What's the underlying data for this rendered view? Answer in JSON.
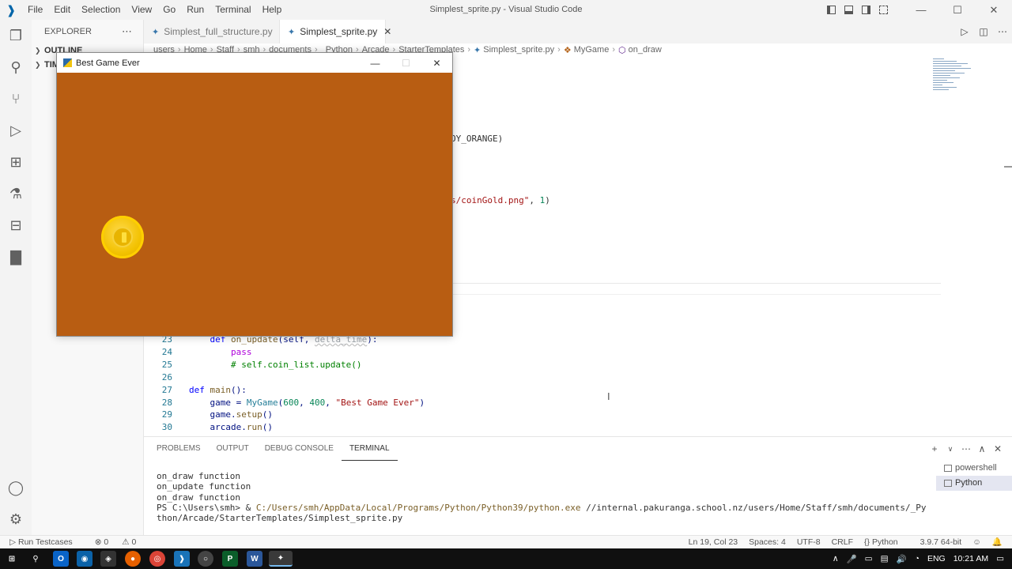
{
  "window": {
    "title": "Simplest_sprite.py - Visual Studio Code"
  },
  "menu": [
    "File",
    "Edit",
    "Selection",
    "View",
    "Go",
    "Run",
    "Terminal",
    "Help"
  ],
  "sidebar": {
    "header": "EXPLORER",
    "more": "⋯",
    "sections": [
      {
        "label": "OUTLINE"
      },
      {
        "label": "TIM"
      }
    ]
  },
  "tabs": [
    {
      "label": "Simplest_full_structure.py",
      "active": false
    },
    {
      "label": "Simplest_sprite.py",
      "active": true
    }
  ],
  "breadcrumb": [
    "users",
    "Home",
    "Staff",
    "smh",
    "documents",
    "_Python",
    "Arcade",
    "StarterTemplates",
    "Simplest_sprite.py",
    "MyGame",
    "on_draw"
  ],
  "editor": {
    "fragments": {
      "orange_tail": "OY_ORANGE)",
      "coin_path": "s/coinGold.png\"",
      "coin_scale": "1"
    },
    "lines": [
      {
        "num": "23",
        "parts": [
          {
            "t": "    "
          },
          {
            "t": "def",
            "c": "kw"
          },
          {
            "t": " "
          },
          {
            "t": "on_update",
            "c": "fn"
          },
          {
            "t": "(self, "
          },
          {
            "t": "delta_time",
            "c": "param"
          },
          {
            "t": "):"
          }
        ]
      },
      {
        "num": "24",
        "parts": [
          {
            "t": "        "
          },
          {
            "t": "pass",
            "c": "kw2"
          }
        ]
      },
      {
        "num": "25",
        "parts": [
          {
            "t": "        "
          },
          {
            "t": "# self.coin_list.update()",
            "c": "cmt"
          }
        ]
      },
      {
        "num": "26",
        "parts": []
      },
      {
        "num": "27",
        "parts": [
          {
            "t": "def",
            "c": "kw"
          },
          {
            "t": " "
          },
          {
            "t": "main",
            "c": "fn"
          },
          {
            "t": "():"
          }
        ]
      },
      {
        "num": "28",
        "parts": [
          {
            "t": "    game = "
          },
          {
            "t": "MyGame",
            "c": "cls"
          },
          {
            "t": "("
          },
          {
            "t": "600",
            "c": "num"
          },
          {
            "t": ", "
          },
          {
            "t": "400",
            "c": "num"
          },
          {
            "t": ", "
          },
          {
            "t": "\"Best Game Ever\"",
            "c": "str"
          },
          {
            "t": ")"
          }
        ]
      },
      {
        "num": "29",
        "parts": [
          {
            "t": "    game."
          },
          {
            "t": "setup",
            "c": "fn"
          },
          {
            "t": "()"
          }
        ]
      },
      {
        "num": "30",
        "parts": [
          {
            "t": "    arcade."
          },
          {
            "t": "run",
            "c": "fn"
          },
          {
            "t": "()"
          }
        ]
      }
    ]
  },
  "panel": {
    "tabs": [
      {
        "label": "PROBLEMS",
        "active": false
      },
      {
        "label": "OUTPUT",
        "active": false
      },
      {
        "label": "DEBUG CONSOLE",
        "active": false
      },
      {
        "label": "TERMINAL",
        "active": true
      }
    ],
    "terminal": {
      "lines": [
        "on_draw function",
        "on_update function",
        "on_draw function"
      ],
      "prompt": "PS C:\\Users\\smh> & ",
      "exe": "C:/Users/smh/AppData/Local/Programs/Python/Python39/python.exe",
      "script": " //internal.pakuranga.school.nz/users/Home/Staff/smh/documents/_Python/Arcade/StarterTemplates/Simplest_sprite.py"
    },
    "terminals": [
      {
        "label": "powershell",
        "selected": false
      },
      {
        "label": "Python",
        "selected": true
      }
    ]
  },
  "statusbar": {
    "left": {
      "run_testcases": "Run Testcases",
      "errors": "0",
      "warnings": "0"
    },
    "right": {
      "position": "Ln 19, Col 23",
      "spaces": "Spaces: 4",
      "encoding": "UTF-8",
      "eol": "CRLF",
      "language": "Python",
      "interpreter": "3.9.7 64-bit"
    }
  },
  "taskbar": {
    "lang": "ENG",
    "time": "10:21 AM"
  },
  "game_window": {
    "title": "Best Game Ever",
    "background_color": "#b85d12",
    "coin_color": "#f2c100"
  },
  "colors": {
    "accent": "#007acc",
    "activity_icon": "#616161"
  }
}
